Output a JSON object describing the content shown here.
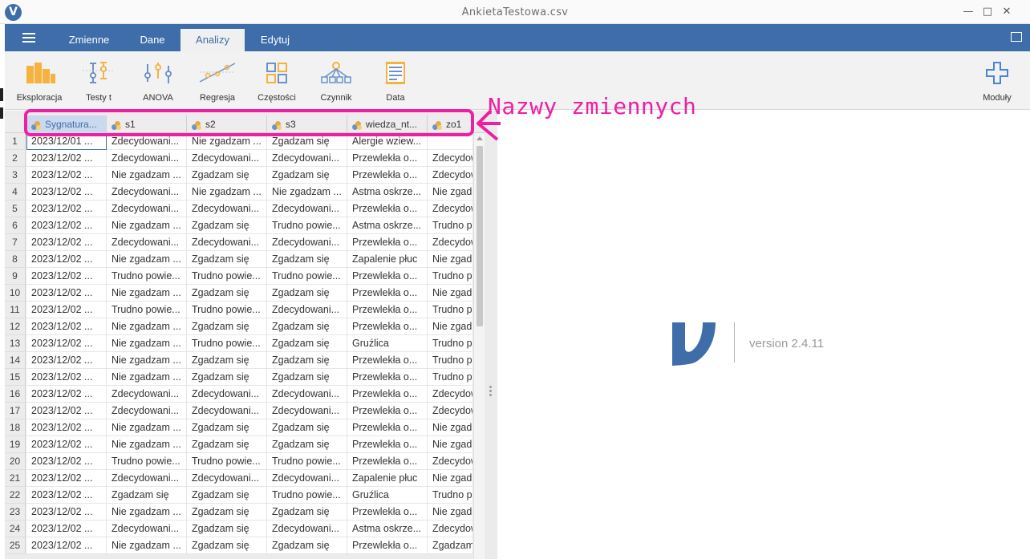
{
  "window": {
    "title": "AnkietaTestowa.csv",
    "minimize": "—",
    "maximize": "□",
    "close": "✕"
  },
  "tabs": [
    {
      "label": "Zmienne"
    },
    {
      "label": "Dane"
    },
    {
      "label": "Analizy",
      "active": true
    },
    {
      "label": "Edytuj"
    }
  ],
  "toolbar": {
    "tools": [
      {
        "label": "Eksploracja",
        "icon": "exploration-bar-icon"
      },
      {
        "label": "Testy t",
        "icon": "t-test-icon"
      },
      {
        "label": "ANOVA",
        "icon": "anova-icon"
      },
      {
        "label": "Regresja",
        "icon": "regression-icon"
      },
      {
        "label": "Częstości",
        "icon": "frequencies-icon"
      },
      {
        "label": "Czynnik",
        "icon": "factor-icon"
      },
      {
        "label": "Data",
        "icon": "data-icon"
      }
    ],
    "modules_label": "Moduły"
  },
  "grid": {
    "columns": [
      "Sygnatura...",
      "s1",
      "s2",
      "s3",
      "wiedza_nt...",
      "zo1"
    ],
    "rows": [
      {
        "n": "1",
        "cells": [
          "2023/12/01 ...",
          "Zdecydowani...",
          "Nie zgadzam ...",
          "Zgadzam się",
          "Alergie wziew...",
          ""
        ]
      },
      {
        "n": "2",
        "cells": [
          "2023/12/02 ...",
          "Zdecydowani...",
          "Zdecydowani...",
          "Zdecydowani...",
          "Przewlekła o...",
          "Zdecydow"
        ]
      },
      {
        "n": "3",
        "cells": [
          "2023/12/02 ...",
          "Nie zgadzam ...",
          "Zgadzam się",
          "Zgadzam się",
          "Przewlekła o...",
          "Zdecydow"
        ]
      },
      {
        "n": "4",
        "cells": [
          "2023/12/02 ...",
          "Zdecydowani...",
          "Nie zgadzam ...",
          "Nie zgadzam ...",
          "Astma oskrze...",
          "Nie zgad"
        ]
      },
      {
        "n": "5",
        "cells": [
          "2023/12/02 ...",
          "Zdecydowani...",
          "Zdecydowani...",
          "Zdecydowani...",
          "Przewlekła o...",
          "Zdecydow"
        ]
      },
      {
        "n": "6",
        "cells": [
          "2023/12/02 ...",
          "Nie zgadzam ...",
          "Zgadzam się",
          "Trudno powie...",
          "Astma oskrze...",
          "Trudno p"
        ]
      },
      {
        "n": "7",
        "cells": [
          "2023/12/02 ...",
          "Zdecydowani...",
          "Zdecydowani...",
          "Zdecydowani...",
          "Przewlekła o...",
          "Zdecydow"
        ]
      },
      {
        "n": "8",
        "cells": [
          "2023/12/02 ...",
          "Nie zgadzam ...",
          "Zgadzam się",
          "Zgadzam się",
          "Zapalenie płuc",
          "Nie zgad"
        ]
      },
      {
        "n": "9",
        "cells": [
          "2023/12/02 ...",
          "Trudno powie...",
          "Trudno powie...",
          "Trudno powie...",
          "Przewlekła o...",
          "Trudno p"
        ]
      },
      {
        "n": "10",
        "cells": [
          "2023/12/02 ...",
          "Nie zgadzam ...",
          "Zgadzam się",
          "Zgadzam się",
          "Przewlekła o...",
          "Nie zgad"
        ]
      },
      {
        "n": "11",
        "cells": [
          "2023/12/02 ...",
          "Trudno powie...",
          "Trudno powie...",
          "Zdecydowani...",
          "Przewlekła o...",
          "Trudno p"
        ]
      },
      {
        "n": "12",
        "cells": [
          "2023/12/02 ...",
          "Nie zgadzam ...",
          "Zgadzam się",
          "Zgadzam się",
          "Przewlekła o...",
          "Nie zgad"
        ]
      },
      {
        "n": "13",
        "cells": [
          "2023/12/02 ...",
          "Nie zgadzam ...",
          "Trudno powie...",
          "Zgadzam się",
          "Gruźlica",
          "Trudno p"
        ]
      },
      {
        "n": "14",
        "cells": [
          "2023/12/02 ...",
          "Nie zgadzam ...",
          "Zgadzam się",
          "Zgadzam się",
          "Przewlekła o...",
          "Trudno p"
        ]
      },
      {
        "n": "15",
        "cells": [
          "2023/12/02 ...",
          "Nie zgadzam ...",
          "Zgadzam się",
          "Zgadzam się",
          "Przewlekła o...",
          "Trudno p"
        ]
      },
      {
        "n": "16",
        "cells": [
          "2023/12/02 ...",
          "Zdecydowani...",
          "Zdecydowani...",
          "Zdecydowani...",
          "Przewlekła o...",
          "Zdecydow"
        ]
      },
      {
        "n": "17",
        "cells": [
          "2023/12/02 ...",
          "Zdecydowani...",
          "Zdecydowani...",
          "Zdecydowani...",
          "Przewlekła o...",
          "Zdecydow"
        ]
      },
      {
        "n": "18",
        "cells": [
          "2023/12/02 ...",
          "Nie zgadzam ...",
          "Zgadzam się",
          "Zgadzam się",
          "Przewlekła o...",
          "Nie zgad"
        ]
      },
      {
        "n": "19",
        "cells": [
          "2023/12/02 ...",
          "Nie zgadzam ...",
          "Zgadzam się",
          "Zgadzam się",
          "Przewlekła o...",
          "Nie zgad"
        ]
      },
      {
        "n": "20",
        "cells": [
          "2023/12/02 ...",
          "Trudno powie...",
          "Trudno powie...",
          "Trudno powie...",
          "Przewlekła o...",
          "Zdecydow"
        ]
      },
      {
        "n": "21",
        "cells": [
          "2023/12/02 ...",
          "Zdecydowani...",
          "Zdecydowani...",
          "Zdecydowani...",
          "Zapalenie płuc",
          "Nie zgad"
        ]
      },
      {
        "n": "22",
        "cells": [
          "2023/12/02 ...",
          "Zgadzam się",
          "Zgadzam się",
          "Trudno powie...",
          "Gruźlica",
          "Trudno p"
        ]
      },
      {
        "n": "23",
        "cells": [
          "2023/12/02 ...",
          "Nie zgadzam ...",
          "Zgadzam się",
          "Zgadzam się",
          "Przewlekła o...",
          "Nie zgad"
        ]
      },
      {
        "n": "24",
        "cells": [
          "2023/12/02 ...",
          "Zdecydowani...",
          "Zgadzam się",
          "Zdecydowani...",
          "Astma oskrze...",
          "Zdecydow"
        ]
      },
      {
        "n": "25",
        "cells": [
          "2023/12/02 ...",
          "Nie zgadzam ...",
          "Zgadzam się",
          "Zgadzam się",
          "Przewlekła o...",
          "Zgadzam"
        ]
      }
    ]
  },
  "results": {
    "version": "version 2.4.11"
  },
  "annotation": {
    "text": "Nazwy zmiennych",
    "color": "#ee1fa3"
  },
  "colors": {
    "accent": "#3e6da9",
    "annotation": "#ee1fa3"
  }
}
